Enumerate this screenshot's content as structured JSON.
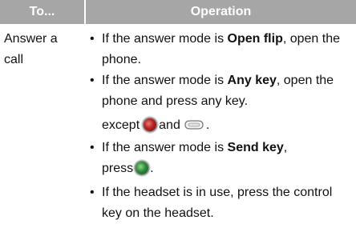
{
  "table": {
    "headers": {
      "col1": "To...",
      "col2": "Operation"
    },
    "row": {
      "label": "Answer a call",
      "items": [
        {
          "pre": "If the answer mode is ",
          "bold": "Open flip",
          "post": ", open the phone."
        },
        {
          "pre": "If the answer mode is ",
          "bold": "Any key",
          "post": ", open the phone and press any key.",
          "continuation": {
            "pre": "except",
            "mid": "and",
            "post": ".",
            "icons": [
              "end-key-icon",
              "side-key-icon"
            ]
          }
        },
        {
          "pre": "If the answer mode is ",
          "bold": "Send key",
          "post": ",",
          "line2": "press",
          "line2_post": ".",
          "icons": [
            "send-key-icon"
          ]
        },
        {
          "text": "If the headset is in use, press the control key on the headset."
        }
      ]
    }
  },
  "colors": {
    "header_bg": "#a6a6a6",
    "header_text": "#ffffff",
    "end_key": "#b82020",
    "send_key": "#2e8b3a"
  }
}
